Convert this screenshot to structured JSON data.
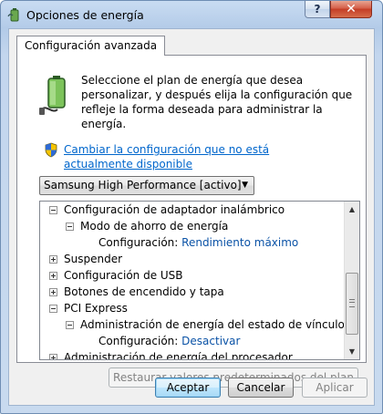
{
  "window": {
    "title": "Opciones de energía",
    "help_label": "?",
    "close_label": "✕"
  },
  "tab": {
    "label": "Configuración avanzada"
  },
  "description": "Seleccione el plan de energía que desea personalizar, y después elija la configuración que refleje la forma deseada para administrar la energía.",
  "link": "Cambiar la configuración que no está actualmente disponible",
  "plan_select": {
    "selected": "Samsung High Performance [activo]"
  },
  "tree": {
    "items": [
      {
        "label": "Configuración de adaptador inalámbrico",
        "level": 0,
        "expander": "minus"
      },
      {
        "label": "Modo de ahorro de energía",
        "level": 1,
        "expander": "minus"
      },
      {
        "label": "Configuración:",
        "value": "Rendimiento máximo",
        "level": 2,
        "expander": "none"
      },
      {
        "label": "Suspender",
        "level": 0,
        "expander": "plus"
      },
      {
        "label": "Configuración de USB",
        "level": 0,
        "expander": "plus"
      },
      {
        "label": "Botones de encendido y tapa",
        "level": 0,
        "expander": "plus"
      },
      {
        "label": "PCI Express",
        "level": 0,
        "expander": "minus"
      },
      {
        "label": "Administración de energía del estado de vínculos",
        "level": 1,
        "expander": "minus"
      },
      {
        "label": "Configuración:",
        "value": "Desactivar",
        "level": 2,
        "expander": "none"
      },
      {
        "label": "Administración de energía del procesador",
        "level": 0,
        "expander": "plus"
      }
    ]
  },
  "restore_button": "Restaurar valores predeterminados del plan",
  "buttons": {
    "ok": "Aceptar",
    "cancel": "Cancelar",
    "apply": "Aplicar"
  },
  "colors": {
    "link": "#0066cc",
    "value": "#0a52a6",
    "close": "#c43d26"
  },
  "icons": {
    "app": "power-options-icon",
    "battery": "battery-plug-icon",
    "shield": "uac-shield-icon"
  }
}
